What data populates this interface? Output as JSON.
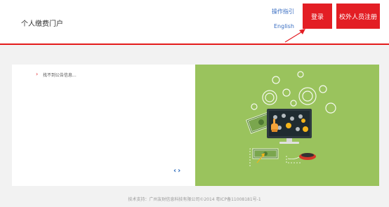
{
  "header": {
    "title": "个人缴费门户",
    "guide_link": "操作指引",
    "lang_link": "English",
    "login_button": "登录",
    "register_button": "校外人员注册"
  },
  "notice": {
    "text": "找不到公告信息..."
  },
  "pager": {
    "prev": "‹",
    "next": "›"
  },
  "footer": {
    "text": "技术支持：广州友财信息科技有限公司©2014 粤ICP备11008181号-1"
  },
  "colors": {
    "brand_red": "#e31e24",
    "link_blue": "#3a6ec2",
    "banner_green": "#9ac35d"
  }
}
